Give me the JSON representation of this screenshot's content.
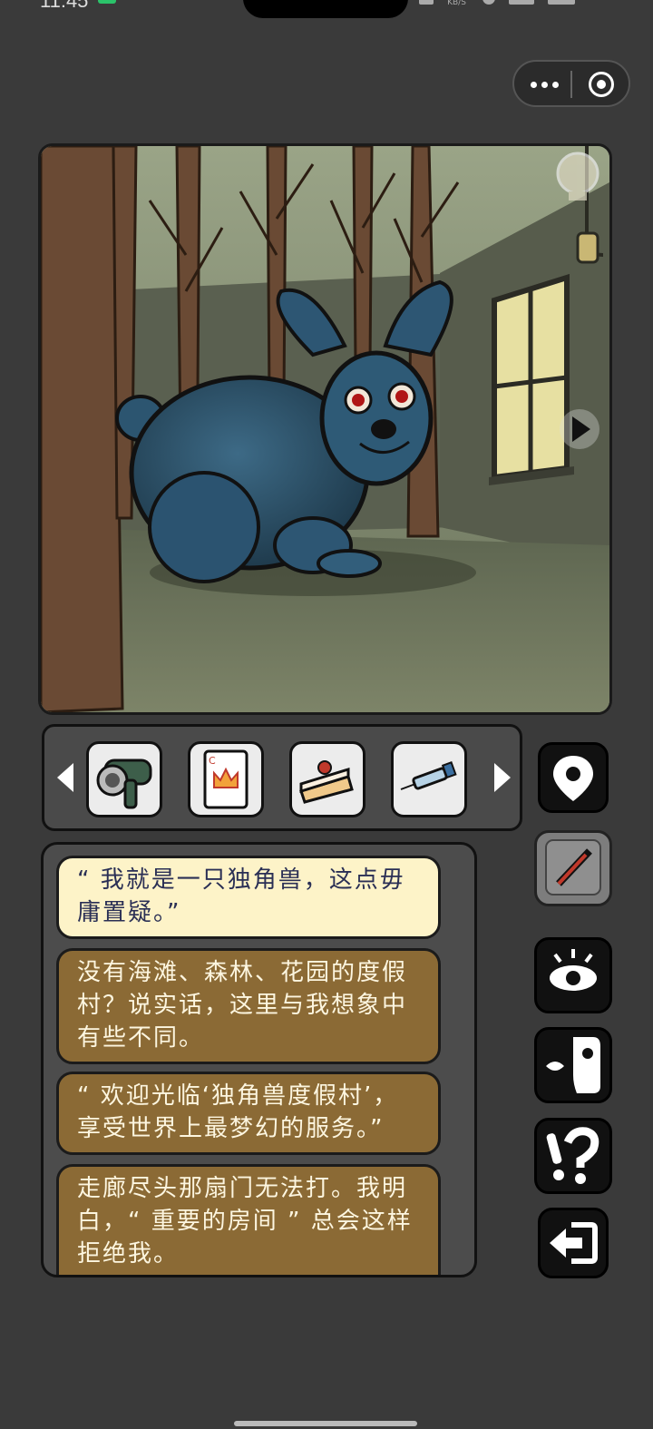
{
  "status_bar": {
    "time": "11:45",
    "network_speed": "KB/S"
  },
  "capsule": {
    "more_icon": "more-dots-icon",
    "close_icon": "target-circle-icon"
  },
  "scene": {
    "hint_icon": "lightbulb-icon",
    "next_icon": "play-arrow-icon",
    "description_icon": "blue-bunny-character"
  },
  "inventory": {
    "items": [
      {
        "name": "hair-dryer",
        "icon": "hair-dryer-icon"
      },
      {
        "name": "playing-card",
        "icon": "crown-card-icon",
        "card_letter": "C"
      },
      {
        "name": "cake-slice",
        "icon": "cake-slice-icon"
      },
      {
        "name": "syringe",
        "icon": "syringe-icon"
      }
    ]
  },
  "side_buttons": [
    {
      "name": "map",
      "icon": "map-pin-icon"
    },
    {
      "name": "notes",
      "icon": "pencil-icon"
    },
    {
      "name": "look",
      "icon": "eye-icon"
    },
    {
      "name": "talk",
      "icon": "talk-face-icon"
    },
    {
      "name": "hint",
      "icon": "question-exclamation-icon"
    },
    {
      "name": "exit",
      "icon": "exit-arrow-icon"
    }
  ],
  "dialog": {
    "lines": [
      "“ 我就是一只独角兽，这点毋庸置疑。”",
      "没有海滩、森林、花园的度假村？说实话，这里与我想象中有些不同。",
      "“ 欢迎光临‘独角兽度假村’，享受世界上最梦幻的服务。”",
      "走廊尽头那扇门无法打。我明白，“ 重要的房间 ” 总会这样拒绝我。"
    ]
  },
  "colors": {
    "background": "#3a3a3a",
    "bubble_light": "#fdf3c8",
    "bubble_dark": "#8b6a35"
  }
}
